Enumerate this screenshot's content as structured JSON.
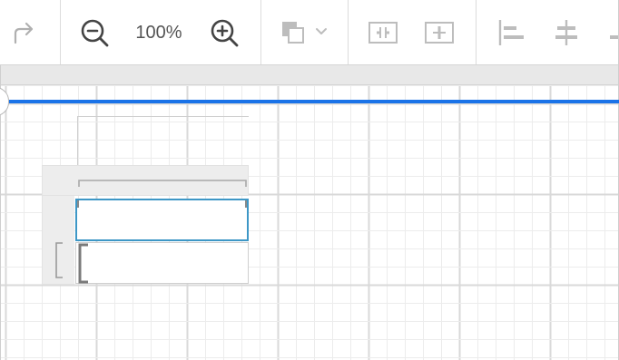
{
  "toolbar": {
    "zoom_level": "100%",
    "buttons": [
      {
        "name": "redo",
        "icon": "redo-icon",
        "enabled": false
      },
      {
        "name": "zoom-out",
        "icon": "zoom-out-icon",
        "enabled": true
      },
      {
        "name": "zoom-in",
        "icon": "zoom-in-icon",
        "enabled": true
      },
      {
        "name": "fill-color",
        "icon": "fill-color-icon",
        "enabled": false
      },
      {
        "name": "distribute-horizontal",
        "icon": "distribute-horizontal-icon",
        "enabled": false
      },
      {
        "name": "distribute-vertical",
        "icon": "distribute-vertical-icon",
        "enabled": false
      },
      {
        "name": "align-left",
        "icon": "align-left-icon",
        "enabled": false
      },
      {
        "name": "align-center",
        "icon": "align-center-icon",
        "enabled": false
      }
    ]
  },
  "colors": {
    "accent": "#1a73e8",
    "selection": "#3d97c6",
    "icon_active": "#444444",
    "icon_disabled": "#b0b0b0",
    "grid_minor": "#ececec",
    "grid_major": "#d9d9d9"
  }
}
